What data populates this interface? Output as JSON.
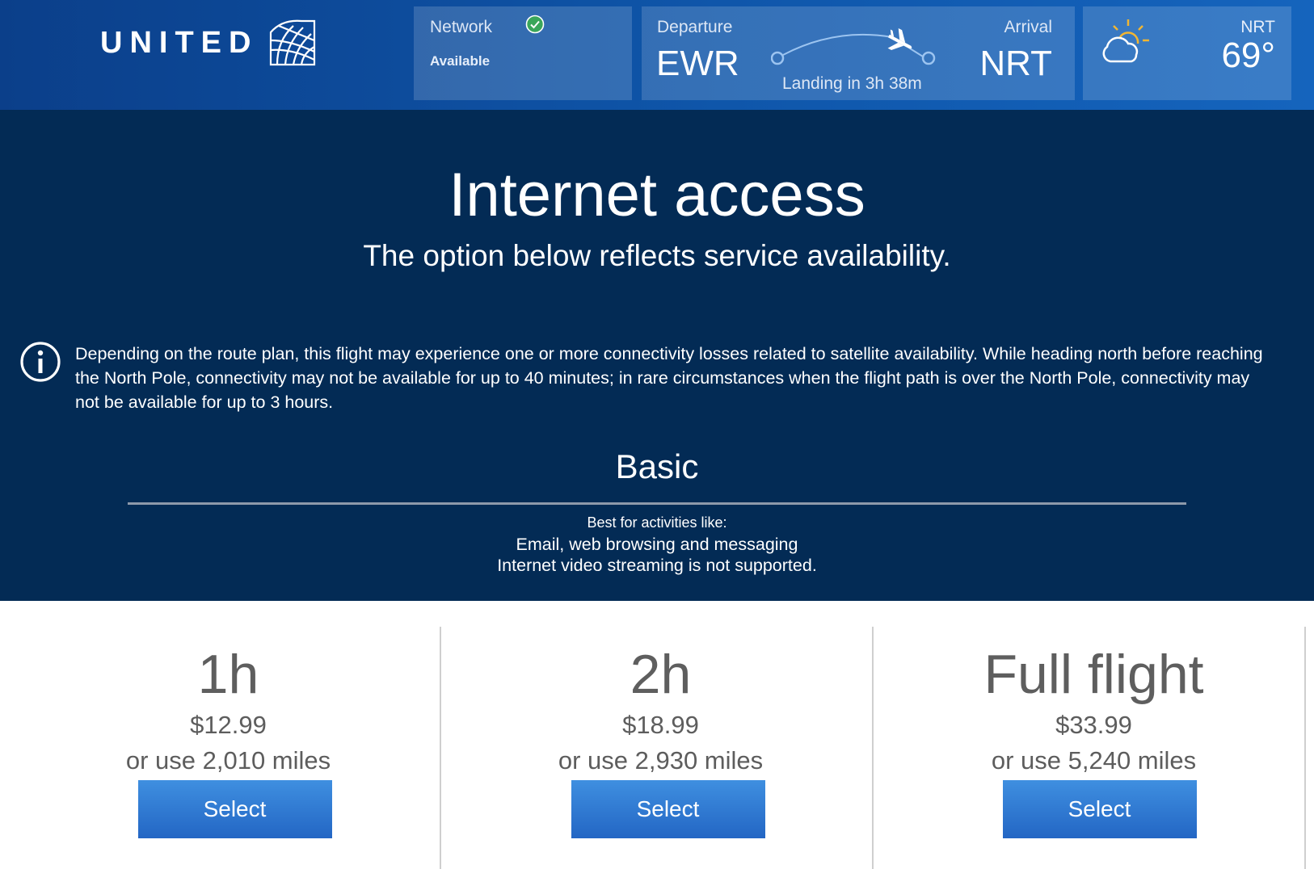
{
  "header": {
    "brand": "UNITED",
    "network": {
      "label": "Network",
      "status": "Available"
    },
    "flight": {
      "departure_label": "Departure",
      "departure_code": "EWR",
      "arrival_label": "Arrival",
      "arrival_code": "NRT",
      "landing_text": "Landing in 3h 38m"
    },
    "weather": {
      "city": "NRT",
      "temperature": "69°",
      "icon": "partly-cloudy-icon"
    }
  },
  "main": {
    "title": "Internet access",
    "subtitle": "The option below reflects service availability.",
    "notice": "Depending on the route plan, this flight may experience one or more connectivity losses related to satellite availability. While heading north before reaching the North Pole, connectivity may not be available for up to 40 minutes; in rare circumstances when the flight path is over the North Pole, connectivity may not be available for up to 3 hours.",
    "tier_name": "Basic",
    "best_for_label": "Best for activities like:",
    "activities": "Email, web browsing and messaging",
    "limitation": "Internet video streaming is not supported."
  },
  "plans": [
    {
      "duration": "1h",
      "price": "$12.99",
      "miles": "or use 2,010 miles",
      "button": "Select"
    },
    {
      "duration": "2h",
      "price": "$18.99",
      "miles": "or use 2,930 miles",
      "button": "Select"
    },
    {
      "duration": "Full flight",
      "price": "$33.99",
      "miles": "or use 5,240 miles",
      "button": "Select"
    }
  ],
  "colors": {
    "header_blue": "#0f56aa",
    "dark_navy": "#032b55",
    "button_blue": "#2f7bd6",
    "check_green": "#3aa65a"
  }
}
